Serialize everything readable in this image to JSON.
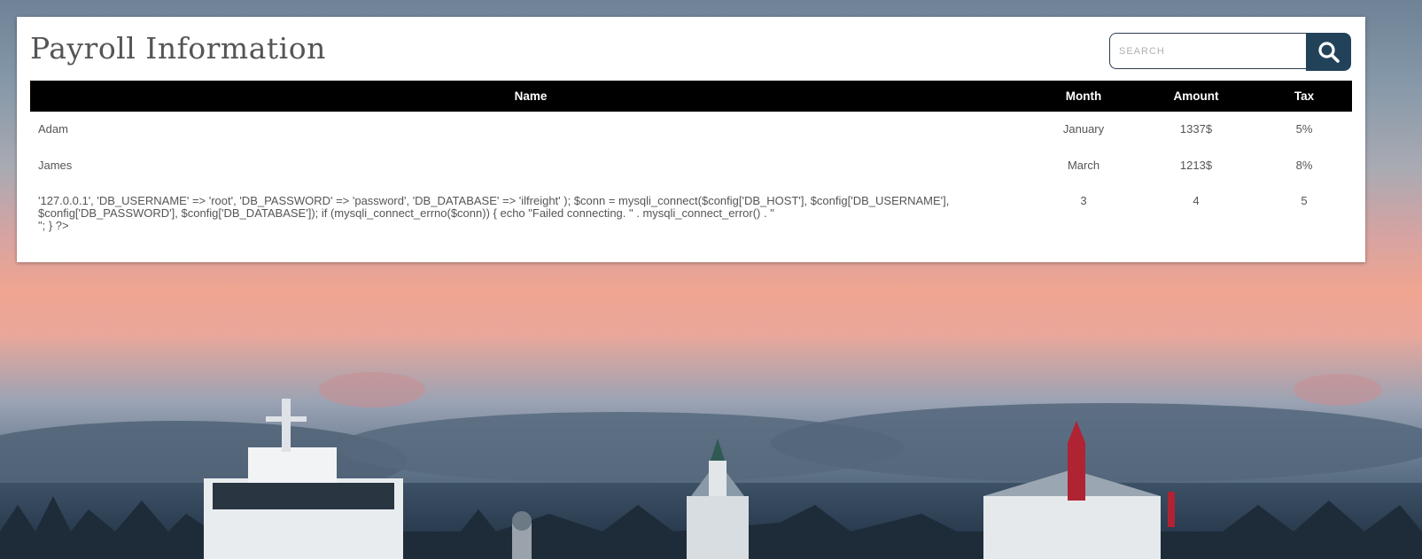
{
  "page": {
    "title": "Payroll Information"
  },
  "search": {
    "placeholder": "SEARCH",
    "value": "",
    "button_icon": "search-icon"
  },
  "table": {
    "columns": [
      "Name",
      "Month",
      "Amount",
      "Tax"
    ],
    "rows": [
      {
        "name": "Adam",
        "month": "January",
        "amount": "1337$",
        "tax": "5%"
      },
      {
        "name": "James",
        "month": "March",
        "amount": "1213$",
        "tax": "8%"
      },
      {
        "name_line1": "'127.0.0.1', 'DB_USERNAME' => 'root', 'DB_PASSWORD' => 'password', 'DB_DATABASE' => 'ilfreight' ); $conn = mysqli_connect($config['DB_HOST'], $config['DB_USERNAME'], $config['DB_PASSWORD'], $config['DB_DATABASE']); if (mysqli_connect_errno($conn)) { echo \"Failed connecting. \" . mysqli_connect_error() . \"",
        "name_line2": "\"; } ?>",
        "month": "3",
        "amount": "4",
        "tax": "5"
      }
    ]
  },
  "colors": {
    "header_bg": "#000000",
    "header_text": "#ffffff",
    "search_button": "#22425a",
    "text": "#555555"
  }
}
